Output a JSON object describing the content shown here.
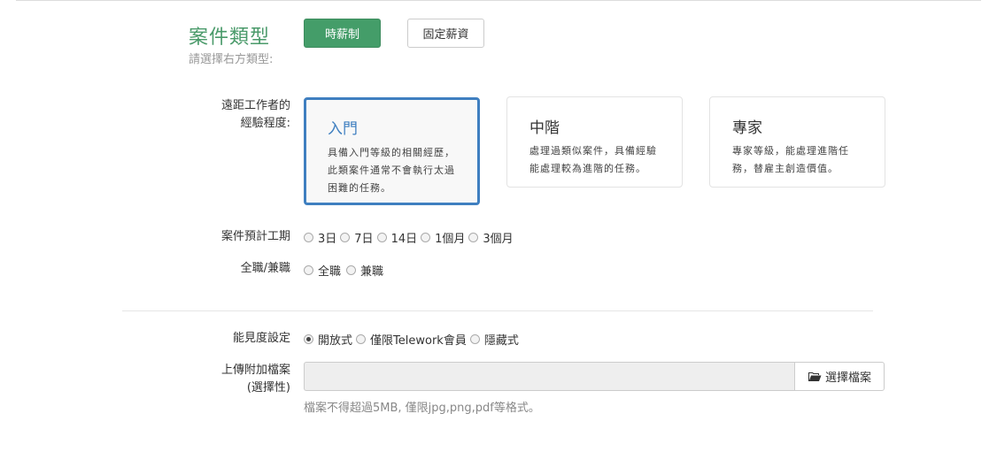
{
  "header": {
    "title": "案件類型",
    "subtitle": "請選擇右方類型:",
    "type_buttons": [
      "時薪制",
      "固定薪資"
    ]
  },
  "experience": {
    "label_line1": "遠距工作者的",
    "label_line2": "經驗程度:",
    "cards": [
      {
        "title": "入門",
        "desc_lines": [
          "具備入門等級的相關經歷，",
          "此類案件通常不會執行太過",
          "困難的任務。"
        ]
      },
      {
        "title": "中階",
        "desc_lines": [
          "處理過類似案件，具備經驗",
          "能處理較為進階的任務。"
        ]
      },
      {
        "title": "專家",
        "desc_lines": [
          "專家等級，能處理進階任",
          "務，替雇主創造價值。"
        ]
      }
    ]
  },
  "duration": {
    "label": "案件預計工期",
    "options": [
      "3日",
      "7日",
      "14日",
      "1個月",
      "3個月"
    ]
  },
  "worktype": {
    "label": "全職/兼職",
    "options": [
      "全職",
      "兼職"
    ]
  },
  "visibility": {
    "label": "能見度設定",
    "options": [
      "開放式",
      "僅限Telework會員",
      "隱藏式"
    ]
  },
  "upload": {
    "label_line1": "上傳附加檔案",
    "label_line2": "(選擇性)",
    "button_label": "選擇檔案",
    "help": "檔案不得超過5MB, 僅限jpg,png,pdf等格式。"
  },
  "colors": {
    "accent_green": "#449d69",
    "accent_blue": "#3f7fc0"
  }
}
